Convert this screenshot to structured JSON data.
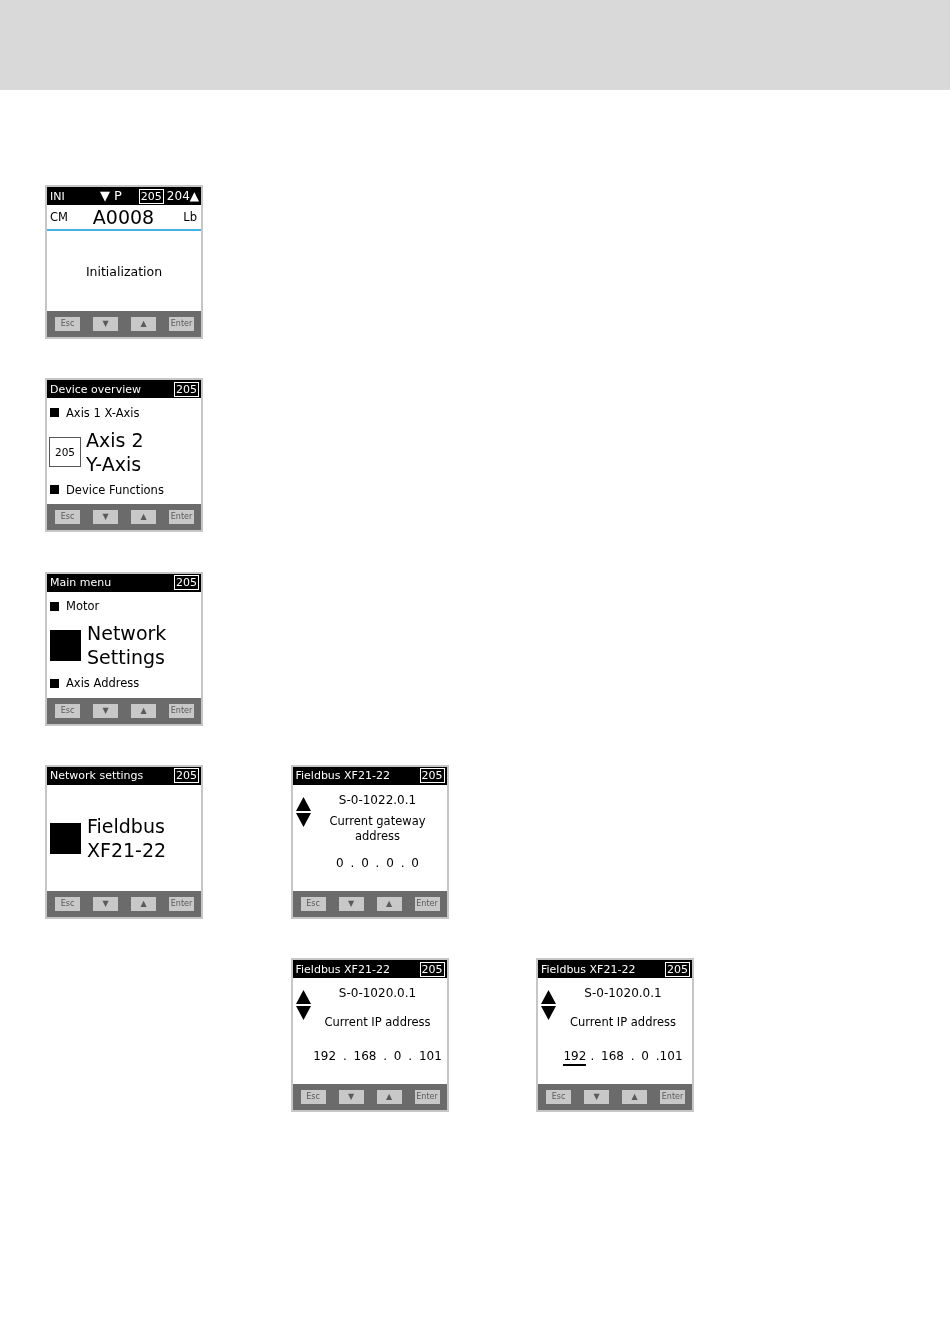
{
  "rows": [
    {
      "indented": false,
      "slots": [
        {
          "kind": "status",
          "mode": "INI",
          "direction": "▼ P",
          "address": "205",
          "next_address": "204▲",
          "left_label": "CM",
          "device_code": "A0008",
          "right_label": "Lb",
          "message": "Initialization",
          "keys": [
            "Esc",
            "▼",
            "▲",
            "Enter"
          ]
        }
      ]
    },
    {
      "indented": false,
      "slots": [
        {
          "kind": "menu",
          "title": "Device overview",
          "address": "205",
          "items": [
            {
              "label": "Axis 1 X-Axis",
              "selected": false
            },
            {
              "label": "Axis 2\nY-Axis",
              "selected": true,
              "badge": "205"
            },
            {
              "label": "Device Functions",
              "selected": false
            }
          ],
          "keys": [
            "Esc",
            "▼",
            "▲",
            "Enter"
          ]
        }
      ]
    },
    {
      "indented": false,
      "slots": [
        {
          "kind": "menu",
          "title": "Main menu",
          "address": "205",
          "items": [
            {
              "label": "Motor",
              "selected": false
            },
            {
              "label": "Network\nSettings",
              "selected": true
            },
            {
              "label": "Axis Address",
              "selected": false
            }
          ],
          "keys": [
            "Esc",
            "▼",
            "▲",
            "Enter"
          ]
        }
      ]
    },
    {
      "indented": false,
      "slots": [
        {
          "kind": "menu",
          "title": "Network settings",
          "address": "205",
          "items": [
            {
              "label": "Fieldbus\nXF21-22",
              "selected": true
            }
          ],
          "keys": [
            "Esc",
            "▼",
            "▲",
            "Enter"
          ]
        },
        {
          "kind": "parameter",
          "title": "Fieldbus XF21-22",
          "address": "205",
          "parameter": "S-0-1022.0.1",
          "description": "Current gateway address",
          "value_parts": [
            {
              "text": "0 . 0 . 0 . 0",
              "selected": false
            }
          ],
          "keys": [
            "Esc",
            "▼",
            "▲",
            "Enter"
          ]
        }
      ]
    },
    {
      "indented": true,
      "slots": [
        {
          "kind": "parameter",
          "title": "Fieldbus XF21-22",
          "address": "205",
          "parameter": "S-0-1020.0.1",
          "description": "Current IP address",
          "value_parts": [
            {
              "text": "192 . 168 . 0 . 101",
              "selected": false
            }
          ],
          "keys": [
            "Esc",
            "▼",
            "▲",
            "Enter"
          ]
        },
        {
          "kind": "parameter",
          "title": "Fieldbus XF21-22",
          "address": "205",
          "parameter": "S-0-1020.0.1",
          "description": "Current IP address",
          "value_parts": [
            {
              "text": "192",
              "selected": true
            },
            {
              "text": ". 168 . 0 .101",
              "selected": false
            }
          ],
          "keys": [
            "Esc",
            "▼",
            "▲",
            "Enter"
          ]
        }
      ]
    }
  ]
}
